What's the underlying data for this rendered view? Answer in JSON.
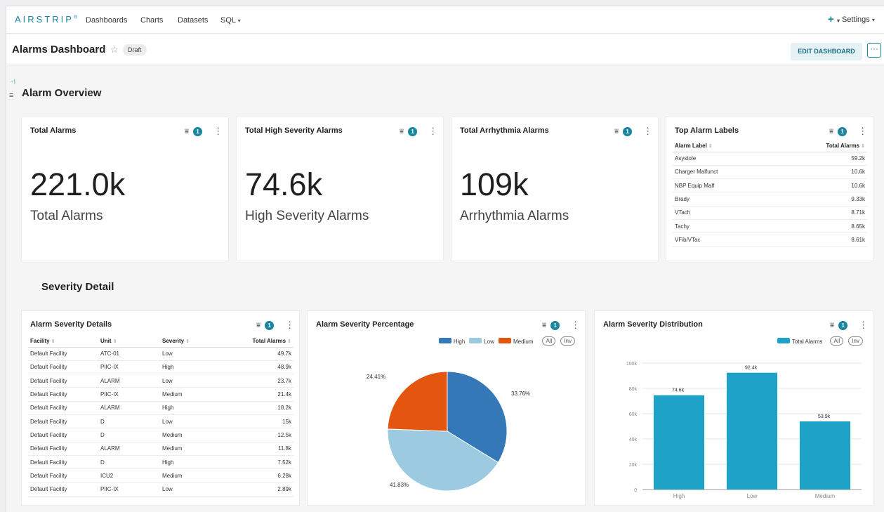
{
  "nav": {
    "brand": "AIRSTRIP",
    "brand_mark": "®",
    "items": [
      "Dashboards",
      "Charts",
      "Datasets",
      "SQL"
    ],
    "plus_label": "+",
    "settings_label": "Settings"
  },
  "header": {
    "title": "Alarms Dashboard",
    "status_badge": "Draft",
    "edit_button": "EDIT DASHBOARD",
    "more_button": "···"
  },
  "sections": {
    "overview_title": "Alarm Overview",
    "severity_title": "Severity Detail"
  },
  "kpis": [
    {
      "title": "Total Alarms",
      "value": "221.0k",
      "subtitle": "Total Alarms",
      "filter_count": "1"
    },
    {
      "title": "Total High Severity Alarms",
      "value": "74.6k",
      "subtitle": "High Severity Alarms",
      "filter_count": "1"
    },
    {
      "title": "Total Arrhythmia Alarms",
      "value": "109k",
      "subtitle": "Arrhythmia Alarms",
      "filter_count": "1"
    }
  ],
  "top_labels": {
    "title": "Top Alarm Labels",
    "filter_count": "1",
    "columns": [
      "Alarm Label",
      "Total Alarms"
    ],
    "rows": [
      [
        "Asystole",
        "59.2k"
      ],
      [
        "Charger Malfunct",
        "10.6k"
      ],
      [
        "NBP Equip Malf",
        "10.6k"
      ],
      [
        "Brady",
        "9.33k"
      ],
      [
        "VTach",
        "8.71k"
      ],
      [
        "Tachy",
        "8.65k"
      ],
      [
        "VFib/VTac",
        "8.61k"
      ]
    ]
  },
  "severity_details": {
    "title": "Alarm Severity Details",
    "filter_count": "1",
    "columns": [
      "Facility",
      "Unit",
      "Severity",
      "Total Alarms"
    ],
    "rows": [
      [
        "Default Facility",
        "ATC-01",
        "Low",
        "49.7k"
      ],
      [
        "Default Facility",
        "PIIC-IX",
        "High",
        "48.9k"
      ],
      [
        "Default Facility",
        "ALARM",
        "Low",
        "23.7k"
      ],
      [
        "Default Facility",
        "PIIC-IX",
        "Medium",
        "21.4k"
      ],
      [
        "Default Facility",
        "ALARM",
        "High",
        "18.2k"
      ],
      [
        "Default Facility",
        "D",
        "Low",
        "15k"
      ],
      [
        "Default Facility",
        "D",
        "Medium",
        "12.5k"
      ],
      [
        "Default Facility",
        "ALARM",
        "Medium",
        "11.8k"
      ],
      [
        "Default Facility",
        "D",
        "High",
        "7.52k"
      ],
      [
        "Default Facility",
        "ICU2",
        "Medium",
        "6.28k"
      ],
      [
        "Default Facility",
        "PIIC-IX",
        "Low",
        "2.89k"
      ]
    ]
  },
  "pie_card": {
    "title": "Alarm Severity Percentage",
    "filter_count": "1",
    "all_label": "All",
    "inv_label": "Inv"
  },
  "bar_card": {
    "title": "Alarm Severity Distribution",
    "filter_count": "1",
    "all_label": "All",
    "inv_label": "Inv"
  },
  "chart_data": [
    {
      "type": "pie",
      "title": "Alarm Severity Percentage",
      "categories": [
        "High",
        "Low",
        "Medium"
      ],
      "values": [
        33.76,
        41.83,
        24.41
      ],
      "data_labels": [
        "33.76%",
        "41.83%",
        "24.41%"
      ],
      "colors": [
        "#3478b8",
        "#9ccae0",
        "#e4560f"
      ],
      "legend": "top-right"
    },
    {
      "type": "bar",
      "title": "Alarm Severity Distribution",
      "categories": [
        "High",
        "Low",
        "Medium"
      ],
      "series": [
        {
          "name": "Total Alarms",
          "values": [
            74.6,
            92.4,
            53.9
          ]
        }
      ],
      "data_labels": [
        "74.6k",
        "92.4k",
        "53.9k"
      ],
      "yticks": [
        "0",
        "20k",
        "40k",
        "60k",
        "80k",
        "100k"
      ],
      "ylim": [
        0,
        100
      ],
      "color": "#1fa2c7",
      "grid": true,
      "legend": "top-right"
    }
  ],
  "colors": {
    "accent": "#1a85a0",
    "bar": "#1fa2c7"
  }
}
